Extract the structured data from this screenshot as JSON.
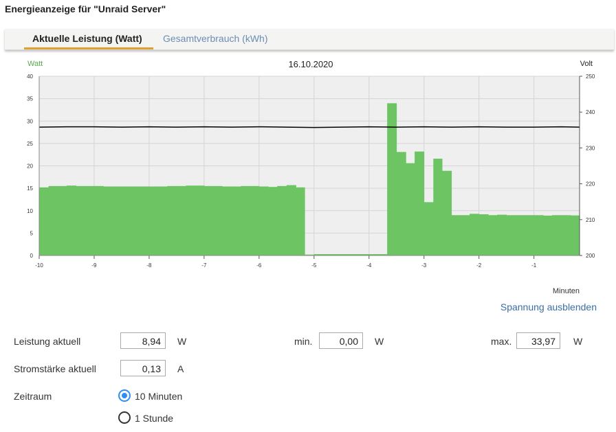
{
  "page_title": "Energieanzeige für \"Unraid Server\"",
  "tabs": [
    {
      "label": "Aktuelle Leistung (Watt)",
      "active": true
    },
    {
      "label": "Gesamtverbrauch (kWh)",
      "active": false
    }
  ],
  "colors": {
    "accent": "#e0a030",
    "bars": "#6cc462",
    "voltage_line": "#000000",
    "link": "#3a6ea5",
    "radio": "#2e8ff0"
  },
  "chart_data": {
    "type": "bar",
    "title": "16.10.2020",
    "ylabel": "Watt",
    "y2label": "Volt",
    "xlabel": "Minuten",
    "ylim": [
      0,
      40
    ],
    "y2lim": [
      200,
      250
    ],
    "xlim": [
      -10,
      -0.17
    ],
    "yticks": [
      "0",
      "5",
      "10",
      "15",
      "20",
      "25",
      "30",
      "35",
      "40"
    ],
    "y2ticks": [
      "200",
      "210",
      "220",
      "230",
      "240",
      "250"
    ],
    "xticks": [
      "-10",
      "-9",
      "-8",
      "-7",
      "-6",
      "-5",
      "-4",
      "-3",
      "-2",
      "-1"
    ],
    "grid": true,
    "series": [
      {
        "name": "Watt",
        "type": "bar",
        "x": [
          -10,
          -9.83,
          -9.67,
          -9.5,
          -9.33,
          -9.17,
          -9,
          -8.83,
          -8.67,
          -8.5,
          -8.33,
          -8.17,
          -8,
          -7.83,
          -7.67,
          -7.5,
          -7.33,
          -7.17,
          -7,
          -6.83,
          -6.67,
          -6.5,
          -6.33,
          -6.17,
          -6,
          -5.83,
          -5.67,
          -5.5,
          -5.33,
          -5.17,
          -5,
          -4.83,
          -4.67,
          -4.5,
          -4.33,
          -4.17,
          -4,
          -3.83,
          -3.67,
          -3.5,
          -3.33,
          -3.17,
          -3,
          -2.83,
          -2.67,
          -2.5,
          -2.33,
          -2.17,
          -2,
          -1.83,
          -1.67,
          -1.5,
          -1.33,
          -1.17,
          -1,
          -0.83,
          -0.67,
          -0.5,
          -0.33
        ],
        "values": [
          15.2,
          15.5,
          15.5,
          15.6,
          15.5,
          15.5,
          15.5,
          15.4,
          15.4,
          15.4,
          15.4,
          15.4,
          15.4,
          15.4,
          15.5,
          15.5,
          15.6,
          15.6,
          15.5,
          15.5,
          15.4,
          15.4,
          15.5,
          15.5,
          15.4,
          15.3,
          15.5,
          15.7,
          15.2,
          0.2,
          0.3,
          0.3,
          0.3,
          0.3,
          0.3,
          0.3,
          0.3,
          0.3,
          33.97,
          23.1,
          20.6,
          23.2,
          11.9,
          21.6,
          18.9,
          9.0,
          9.0,
          9.3,
          9.2,
          9.0,
          9.1,
          9.0,
          9.0,
          9.0,
          9.0,
          8.9,
          9.0,
          9.0,
          8.94
        ]
      },
      {
        "name": "Volt",
        "type": "line",
        "axis": "right",
        "x": [
          -10,
          -9.5,
          -9,
          -8.5,
          -8,
          -7.5,
          -7,
          -6.5,
          -6,
          -5.5,
          -5,
          -4.5,
          -4,
          -3.5,
          -3,
          -2.5,
          -2,
          -1.5,
          -1,
          -0.5,
          -0.17
        ],
        "values": [
          235.8,
          235.9,
          235.9,
          235.8,
          235.9,
          235.8,
          235.9,
          235.8,
          235.9,
          235.8,
          235.7,
          235.8,
          235.9,
          235.8,
          235.9,
          235.8,
          235.9,
          235.8,
          235.8,
          235.9,
          235.8
        ]
      }
    ]
  },
  "toggle_voltage_label": "Spannung ausblenden",
  "stats": {
    "power_label": "Leistung aktuell",
    "power_value": "8,94",
    "power_unit": "W",
    "min_label": "min.",
    "min_value": "0,00",
    "min_unit": "W",
    "max_label": "max.",
    "max_value": "33,97",
    "max_unit": "W",
    "current_label": "Stromstärke aktuell",
    "current_value": "0,13",
    "current_unit": "A"
  },
  "timerange": {
    "label": "Zeitraum",
    "options": [
      {
        "label": "10 Minuten",
        "selected": true
      },
      {
        "label": "1 Stunde",
        "selected": false
      }
    ]
  }
}
